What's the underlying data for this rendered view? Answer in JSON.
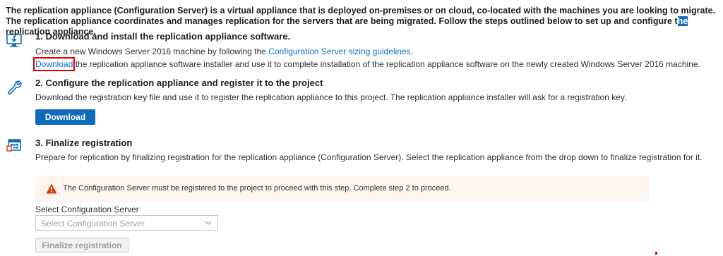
{
  "intro": {
    "text_before": "The replication appliance (Configuration Server) is a virtual appliance that is deployed on-premises or on cloud, co-located with the machines you are looking to migrate. The replication appliance coordinates and manages replication for the servers that are being migrated. Follow the steps outlined below to set up and configure t",
    "text_highlight": "he",
    "text_after": " replication appliance."
  },
  "step1": {
    "icon": "monitor-download-icon",
    "title": "1. Download and install the replication appliance software.",
    "line1_prefix": "Create a new Windows Server 2016 machine by following the ",
    "line1_link": "Configuration Server sizing guidelines",
    "line1_suffix": ".",
    "download_link": "Download",
    "line2_suffix": " the replication appliance software installer and use it to complete installation of the replication appliance software on the newly created Windows Server 2016 machine."
  },
  "step2": {
    "icon": "wrench-icon",
    "title": "2. Configure the replication appliance and register it to the project",
    "text": "Download the registration key file and use it to register the replication appliance to this project. The replication appliance installer will ask for a registration key.",
    "button": "Download"
  },
  "step3": {
    "icon": "calendar-icon",
    "title": "3. Finalize registration",
    "text": "Prepare for replication by finalizing registration for the replication appliance (Configuration Server). Select the replication appliance from the drop down to finalize registration for it.",
    "warning": "The Configuration Server must be registered to the project to proceed with this step. Complete step 2 to proceed.",
    "select_label": "Select Configuration Server",
    "select_placeholder": "Select Configuration Server",
    "finalize_button": "Finalize registration"
  },
  "colors": {
    "accent": "#0f6cbd",
    "warning": "#d83b01",
    "warning_bg": "#fdf6f0"
  }
}
